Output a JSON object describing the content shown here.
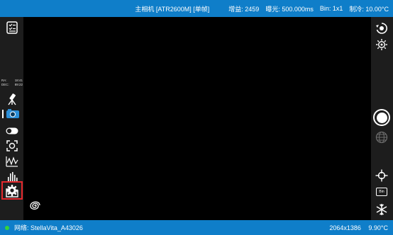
{
  "topbar": {
    "camera": "主相机 [ATR2600M] [单帧]",
    "gain": "增益: 2459",
    "exposure": "曝光: 500.000ms",
    "bin": "Bin: 1x1",
    "cooling": "制冷: 10.00°C"
  },
  "coords": {
    "ra_label": "RA:",
    "ra_value": "18:41",
    "dec_label": "DEC:",
    "dec_value": "89:22"
  },
  "bottombar": {
    "network": "网络: StellaVita_A43026",
    "resolution": "2064x1386",
    "temperature": "9.90°C"
  },
  "bin_button_label": "Bin",
  "colors": {
    "accent": "#0f7ec9",
    "panel": "#1d1d1d",
    "highlight": "#e4282c",
    "status_dot": "#34d43a"
  }
}
